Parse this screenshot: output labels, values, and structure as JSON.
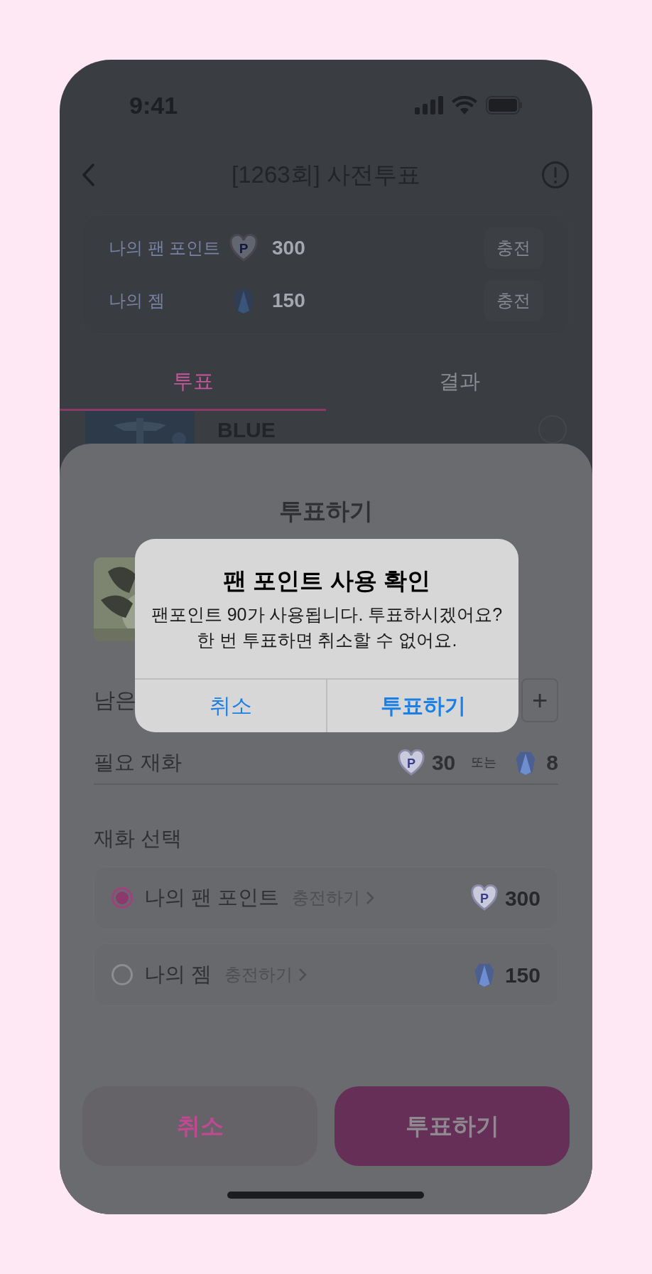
{
  "status_bar": {
    "time": "9:41"
  },
  "header": {
    "title": "[1263회] 사전투표"
  },
  "balances": [
    {
      "kind": "point",
      "label": "나의 팬 포인트",
      "symbol": "P",
      "amount": "300",
      "button": "충전"
    },
    {
      "kind": "gem",
      "label": "나의 젬",
      "amount": "150",
      "button": "충전"
    }
  ],
  "tabs": [
    {
      "label": "투표",
      "selected": true
    },
    {
      "label": "결과",
      "selected": false
    }
  ],
  "candidates": [
    {
      "name": "BLUE",
      "selected": false
    }
  ],
  "sheet": {
    "title": "투표하기",
    "count_label": "남은",
    "plus": "+",
    "cost": {
      "label": "필요 재화",
      "point_symbol": "P",
      "point": "30",
      "separator": "또는",
      "gem": "8"
    },
    "currency_title": "재화 선택",
    "options": [
      {
        "kind": "point",
        "label": "나의 팬 포인트",
        "link": "충전하기",
        "symbol": "P",
        "amount": "300",
        "selected": true
      },
      {
        "kind": "gem",
        "label": "나의 젬",
        "link": "충전하기",
        "amount": "150",
        "selected": false
      }
    ],
    "cancel": "취소",
    "confirm": "투표하기"
  },
  "dialog": {
    "title": "팬 포인트 사용 확인",
    "message": [
      "팬포인트 90가 사용됩니다. 투표하시겠어요?",
      "한 번 투표하면 취소할 수 없어요."
    ],
    "buttons": [
      {
        "label": "취소",
        "kind": "cancel"
      },
      {
        "label": "투표하기",
        "kind": "default"
      }
    ]
  }
}
